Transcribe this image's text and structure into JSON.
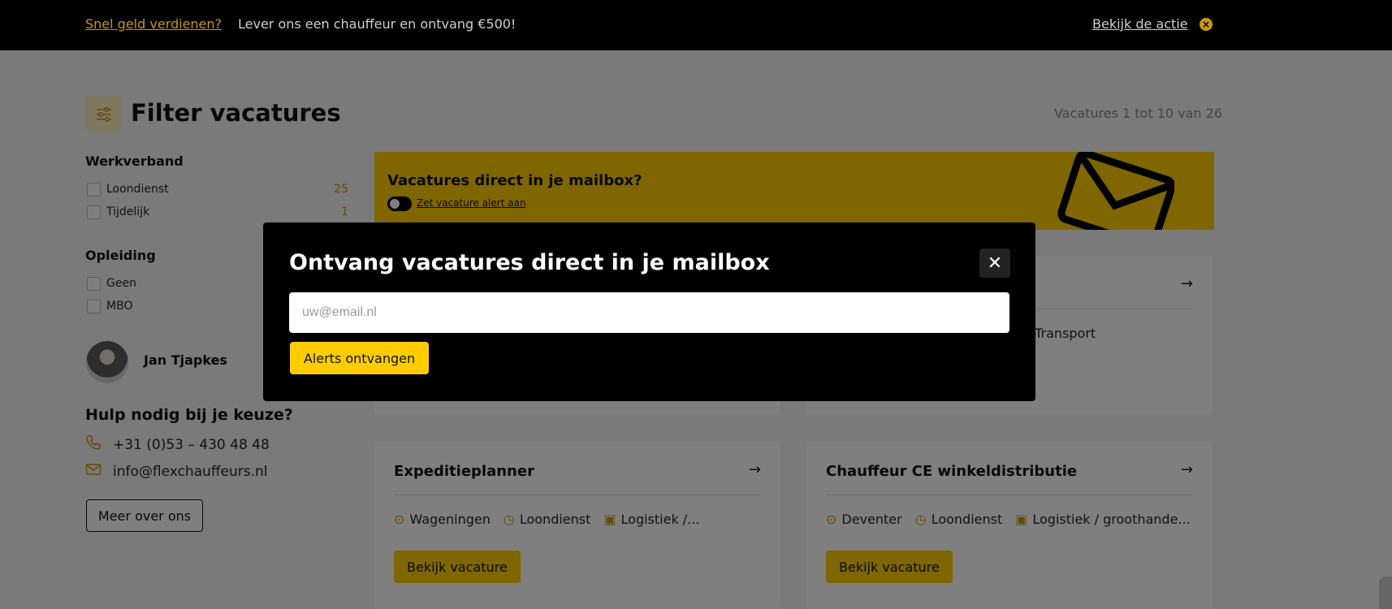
{
  "topbar": {
    "promo_link": "Snel geld verdienen?",
    "promo_text": "Lever ons een chauffeur en ontvang €500!",
    "action_link": "Bekijk de actie",
    "close_glyph": "×"
  },
  "filters": {
    "title": "Filter vacatures",
    "results_count": "Vacatures 1 tot 10 van 26",
    "groups": [
      {
        "title": "Werkverband",
        "options": [
          {
            "label": "Loondienst",
            "count": "25"
          },
          {
            "label": "Tijdelijk",
            "count": "1"
          }
        ]
      },
      {
        "title": "Opleiding",
        "options": [
          {
            "label": "Geen",
            "count": ""
          },
          {
            "label": "MBO",
            "count": ""
          }
        ]
      }
    ]
  },
  "contact": {
    "name": "Jan Tjapkes",
    "help_title": "Hulp nodig bij je keuze?",
    "phone": "+31 (0)53 – 430 48 48",
    "email": "info@flexchauffeurs.nl",
    "more_button": "Meer over ons"
  },
  "alert_banner": {
    "title": "Vacatures direct in je mailbox?",
    "toggle_label": "Zet vacature alert aan"
  },
  "cards": [
    {
      "title": "",
      "meta": [
        {
          "icon": "pin-icon",
          "text": ""
        },
        {
          "icon": "clock-icon",
          "text": ""
        },
        {
          "icon": "briefcase-icon",
          "text": "Transport"
        }
      ],
      "button": ""
    },
    {
      "title": "Expeditieplanner",
      "meta": [
        {
          "icon": "pin-icon",
          "text": "Wageningen"
        },
        {
          "icon": "clock-icon",
          "text": "Loondienst"
        },
        {
          "icon": "briefcase-icon",
          "text": "Logistiek /..."
        }
      ],
      "button": "Bekijk vacature"
    },
    {
      "title": "Chauffeur CE winkeldistributie",
      "meta": [
        {
          "icon": "pin-icon",
          "text": "Deventer"
        },
        {
          "icon": "clock-icon",
          "text": "Loondienst"
        },
        {
          "icon": "briefcase-icon",
          "text": "Logistiek / groothande..."
        }
      ],
      "button": "Bekijk vacature"
    }
  ],
  "modal": {
    "title": "Ontvang vacatures direct in je mailbox",
    "email_placeholder": "uw@email.nl",
    "email_value": "",
    "submit_label": "Alerts ontvangen",
    "close_glyph": "✕"
  },
  "colors": {
    "accent": "#ffcc00",
    "accent_dark": "#c9950d",
    "topbar": "#000000",
    "overlay": "rgba(0,0,0,0.5)"
  }
}
